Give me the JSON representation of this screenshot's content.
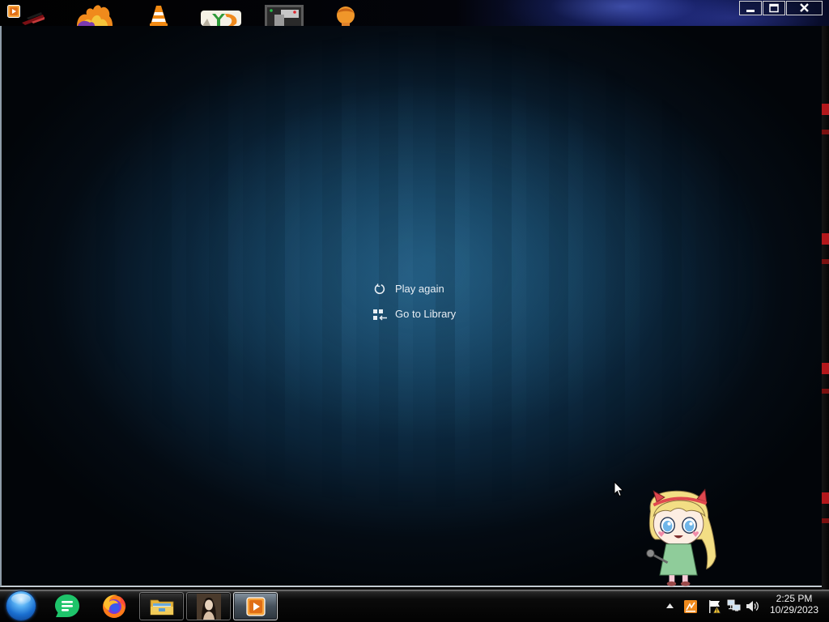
{
  "desktop": {
    "top_icons": [
      "sunglasses-app-icon",
      "flame-app-icon",
      "vlc-cone-icon",
      "yd-logo-icon",
      "gray-window-app-icon",
      "orange-head-icon"
    ]
  },
  "window": {
    "app_icon": "media-player-icon",
    "controls": [
      "minimize-icon",
      "maximize-icon",
      "close-icon"
    ]
  },
  "player": {
    "menu": {
      "play_again": {
        "label": "Play again",
        "icon": "refresh-icon"
      },
      "go_to_library": {
        "label": "Go to Library",
        "icon": "library-grid-icon"
      }
    }
  },
  "taskbar": {
    "start_icon": "start-orb-icon",
    "apps": [
      {
        "icon": "chat-app-icon"
      },
      {
        "icon": "firefox-icon"
      },
      {
        "icon": "file-explorer-icon"
      },
      {
        "icon": "portrait-image-icon"
      },
      {
        "icon": "media-player-icon",
        "active": true
      }
    ],
    "tray_icons": [
      "show-hidden-icons-arrow-icon",
      "orange-app-tray-icon",
      "action-center-flag-icon",
      "network-icon",
      "volume-icon"
    ],
    "clock": {
      "time": "2:25 PM",
      "date": "10/29/2023"
    }
  },
  "colors": {
    "player_glow": "#1c4d70",
    "player_edge": "#020509",
    "menu_text": "#e8eef4",
    "taskbar_bg": "#0a0a0a",
    "start_orb": "#1a6fd0"
  }
}
